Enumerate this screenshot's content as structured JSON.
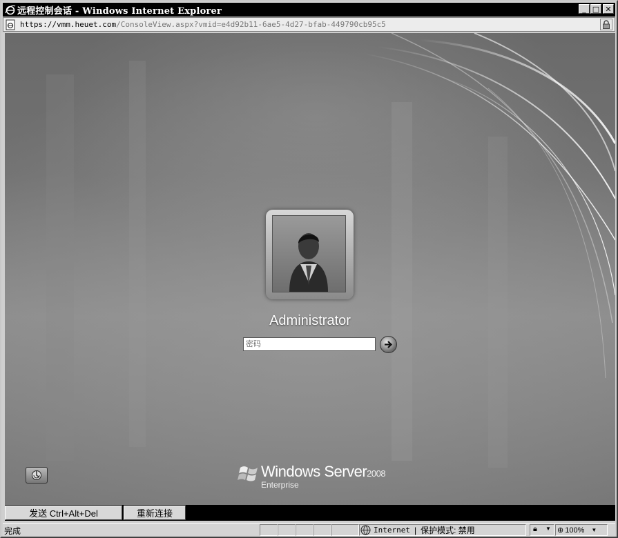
{
  "window": {
    "title": "远程控制会话 - Windows Internet Explorer",
    "controls": {
      "minimize": "_",
      "maximize": "□",
      "close": "✕"
    }
  },
  "address": {
    "host": "https://vmm.heuet.com",
    "path": "/ConsoleView.aspx?vmid=e4d92b11-6ae5-4d27-bfab-449790cb95c5"
  },
  "login": {
    "username": "Administrator",
    "password_placeholder": "密码"
  },
  "brand": {
    "name": "Windows Server",
    "version": "2008",
    "edition": "Enterprise"
  },
  "bottom_buttons": {
    "send_cad": "发送 Ctrl+Alt+Del",
    "reconnect": "重新连接"
  },
  "status": {
    "text": "完成",
    "zone": "Internet",
    "protected_mode": "保护模式: 禁用",
    "zoom": "100%"
  },
  "icons": {
    "title": "ie-logo-icon",
    "address": "page-icon",
    "lock": "lock-icon",
    "go": "arrow-right-icon",
    "ease_of_access": "ease-of-access-icon",
    "brand": "windows-flag-icon",
    "zone": "globe-icon"
  }
}
